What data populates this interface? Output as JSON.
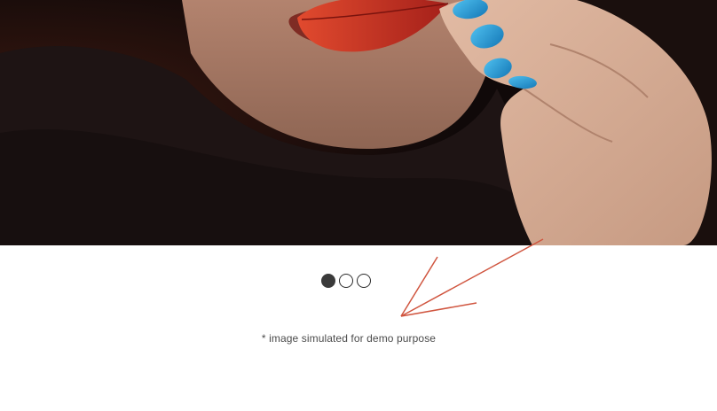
{
  "hero": {
    "image_subject": "lips-with-red-leaf-hand-blue-nails"
  },
  "carousel": {
    "slides": [
      {
        "label": "",
        "active": true
      },
      {
        "label": "",
        "active": false
      },
      {
        "label": "",
        "active": false
      }
    ]
  },
  "annotation": {
    "arrow_color": "#d0553f"
  },
  "footer": {
    "disclaimer": "* image simulated for demo purpose"
  },
  "colors": {
    "nail_blue": "#1a9bd8",
    "leaf_red": "#b3271b",
    "dot_active": "#3a3a3a"
  }
}
